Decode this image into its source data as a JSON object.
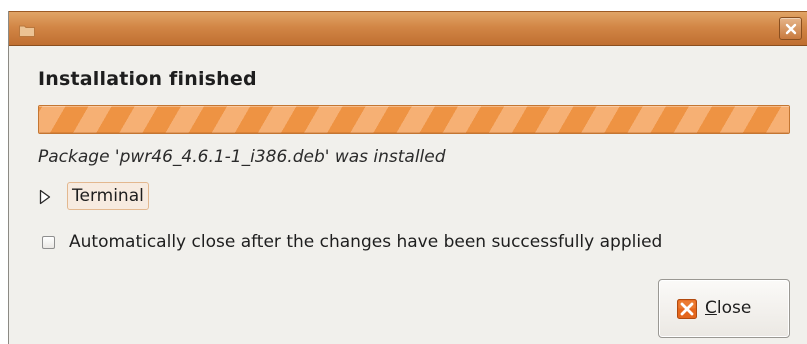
{
  "dialog": {
    "heading": "Installation finished",
    "progress_fraction": 1.0,
    "status_text": "Package 'pwr46_4.6.1-1_i386.deb' was installed",
    "terminal_expander": {
      "label": "Terminal",
      "expanded": false
    },
    "auto_close_checkbox": {
      "label": "Automatically close after the changes have been successfully applied",
      "checked": false
    },
    "close_button": {
      "mnemonic": "C",
      "rest": "lose"
    }
  },
  "colors": {
    "titlebar": "#d28646",
    "progress_light": "#f6b074",
    "progress_dark": "#ee9343",
    "close_icon": "#e4661c"
  },
  "icons": {
    "titlebar": "window-app-icon",
    "titlebar_close": "close-icon",
    "expander": "triangle-right-icon",
    "close_button": "close-x-icon"
  }
}
